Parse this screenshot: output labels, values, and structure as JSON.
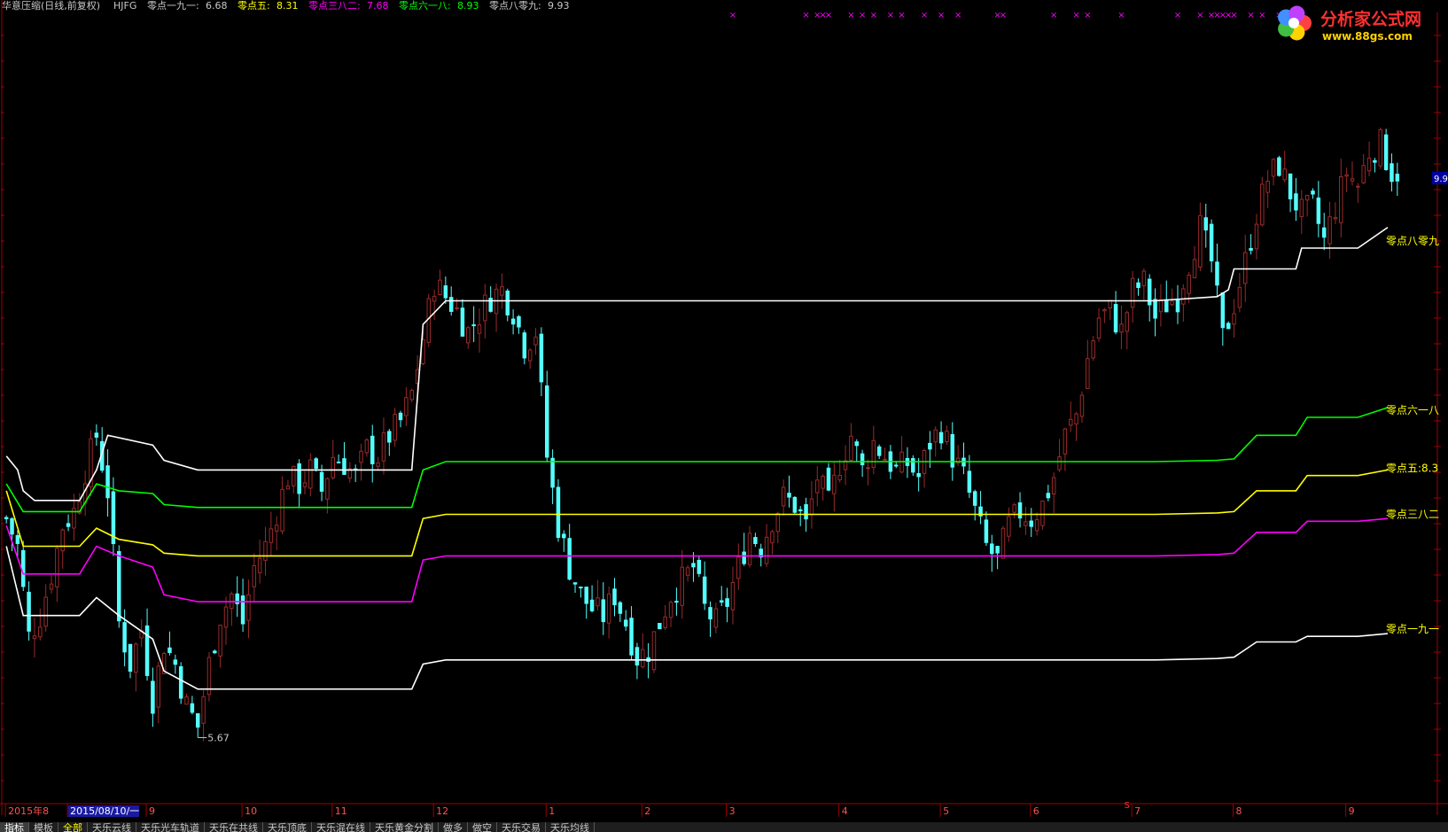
{
  "header": {
    "title": "华意压缩(日线,前复权)",
    "indicator": "HJFG",
    "items": [
      {
        "label": "零点一九一:",
        "value": "6.68",
        "color": "#ffffff"
      },
      {
        "label": "零点五:",
        "value": "8.31",
        "color": "#ffff00"
      },
      {
        "label": "零点三八二:",
        "value": "7.68",
        "color": "#ff00ff"
      },
      {
        "label": "零点六一八:",
        "value": "8.93",
        "color": "#00ff00"
      },
      {
        "label": "零点八零九:",
        "value": "9.93",
        "color": "#ffffff"
      }
    ]
  },
  "logo": {
    "name": "分析家公式网",
    "url": "www.88gs.com"
  },
  "price_scale": {
    "label": "9.9"
  },
  "chart_data": {
    "type": "candlestick",
    "title": "华意压缩(日线,前复权)",
    "ylim": [
      5.2,
      10.9
    ],
    "x_count": 248,
    "low_marker": {
      "index": 34,
      "value": 5.67,
      "label": "5.67"
    },
    "lines": [
      {
        "name": "零点八零九",
        "color": "#ffffff",
        "end_label": "零点八零九",
        "value": 9.93,
        "steps": [
          [
            0,
            7.7
          ],
          [
            2,
            7.6
          ],
          [
            3,
            7.45
          ],
          [
            5,
            7.38
          ],
          [
            13,
            7.38
          ],
          [
            16,
            7.6
          ],
          [
            18,
            7.85
          ],
          [
            26,
            7.78
          ],
          [
            28,
            7.67
          ],
          [
            34,
            7.6
          ],
          [
            50,
            7.6
          ],
          [
            56,
            7.6
          ],
          [
            72,
            7.6
          ],
          [
            74,
            8.65
          ],
          [
            78,
            8.82
          ],
          [
            95,
            8.82
          ],
          [
            204,
            8.82
          ],
          [
            215,
            8.85
          ],
          [
            217,
            8.9
          ],
          [
            218,
            9.05
          ],
          [
            229,
            9.05
          ],
          [
            230,
            9.2
          ],
          [
            240,
            9.2
          ],
          [
            248,
            9.35
          ]
        ]
      },
      {
        "name": "零点六一八",
        "color": "#00ff00",
        "end_label": "零点六一八",
        "value": 8.93,
        "steps": [
          [
            0,
            7.5
          ],
          [
            3,
            7.3
          ],
          [
            13,
            7.3
          ],
          [
            16,
            7.5
          ],
          [
            20,
            7.45
          ],
          [
            26,
            7.43
          ],
          [
            28,
            7.35
          ],
          [
            34,
            7.33
          ],
          [
            72,
            7.33
          ],
          [
            74,
            7.6
          ],
          [
            78,
            7.66
          ],
          [
            95,
            7.66
          ],
          [
            204,
            7.66
          ],
          [
            215,
            7.67
          ],
          [
            218,
            7.68
          ],
          [
            222,
            7.85
          ],
          [
            229,
            7.85
          ],
          [
            231,
            7.98
          ],
          [
            240,
            7.98
          ],
          [
            248,
            8.05
          ]
        ]
      },
      {
        "name": "零点五",
        "color": "#ffff00",
        "end_label": "零点五:8.3",
        "value": 8.31,
        "steps": [
          [
            0,
            7.45
          ],
          [
            3,
            7.05
          ],
          [
            13,
            7.05
          ],
          [
            16,
            7.18
          ],
          [
            20,
            7.1
          ],
          [
            26,
            7.06
          ],
          [
            28,
            7.0
          ],
          [
            34,
            6.98
          ],
          [
            72,
            6.98
          ],
          [
            74,
            7.25
          ],
          [
            78,
            7.28
          ],
          [
            95,
            7.28
          ],
          [
            204,
            7.28
          ],
          [
            215,
            7.29
          ],
          [
            218,
            7.3
          ],
          [
            222,
            7.45
          ],
          [
            229,
            7.45
          ],
          [
            231,
            7.56
          ],
          [
            240,
            7.56
          ],
          [
            248,
            7.6
          ]
        ]
      },
      {
        "name": "零点三八二",
        "color": "#ff00ff",
        "end_label": "零点三八二",
        "value": 7.68,
        "steps": [
          [
            0,
            7.2
          ],
          [
            3,
            6.85
          ],
          [
            13,
            6.85
          ],
          [
            16,
            7.05
          ],
          [
            20,
            6.98
          ],
          [
            26,
            6.9
          ],
          [
            28,
            6.7
          ],
          [
            34,
            6.65
          ],
          [
            72,
            6.65
          ],
          [
            74,
            6.95
          ],
          [
            78,
            6.98
          ],
          [
            95,
            6.98
          ],
          [
            204,
            6.98
          ],
          [
            215,
            6.99
          ],
          [
            218,
            7.0
          ],
          [
            222,
            7.15
          ],
          [
            229,
            7.15
          ],
          [
            231,
            7.23
          ],
          [
            240,
            7.23
          ],
          [
            248,
            7.25
          ]
        ]
      },
      {
        "name": "零点一九一",
        "color": "#ffffff",
        "end_label": "零点一九一",
        "value": 6.68,
        "steps": [
          [
            0,
            7.05
          ],
          [
            3,
            6.55
          ],
          [
            13,
            6.55
          ],
          [
            16,
            6.68
          ],
          [
            20,
            6.55
          ],
          [
            26,
            6.38
          ],
          [
            28,
            6.15
          ],
          [
            34,
            6.02
          ],
          [
            72,
            6.02
          ],
          [
            74,
            6.2
          ],
          [
            78,
            6.23
          ],
          [
            95,
            6.23
          ],
          [
            204,
            6.23
          ],
          [
            215,
            6.24
          ],
          [
            218,
            6.25
          ],
          [
            222,
            6.36
          ],
          [
            229,
            6.36
          ],
          [
            231,
            6.4
          ],
          [
            240,
            6.4
          ],
          [
            248,
            6.42
          ]
        ]
      }
    ],
    "x_ticks": [
      {
        "index": 0,
        "label": "2015年8"
      },
      {
        "index": 11,
        "label": "2015/08/10/一"
      },
      {
        "index": 25,
        "label": "9"
      },
      {
        "index": 42,
        "label": "10"
      },
      {
        "index": 58,
        "label": "11"
      },
      {
        "index": 76,
        "label": "12"
      },
      {
        "index": 96,
        "label": "1"
      },
      {
        "index": 113,
        "label": "2"
      },
      {
        "index": 128,
        "label": "3"
      },
      {
        "index": 148,
        "label": "4"
      },
      {
        "index": 166,
        "label": "5"
      },
      {
        "index": 182,
        "label": "6"
      },
      {
        "index": 200,
        "label": "7"
      },
      {
        "index": 218,
        "label": "8"
      },
      {
        "index": 238,
        "label": "9"
      }
    ],
    "x_marker": {
      "index": 199,
      "label": "S"
    },
    "signal_marks": {
      "label": "×",
      "color": "#ff00ff",
      "indices": [
        129,
        142,
        144,
        145,
        146,
        150,
        152,
        154,
        157,
        159,
        163,
        166,
        169,
        176,
        177,
        186,
        190,
        192,
        198,
        208,
        212,
        214,
        215,
        216,
        217,
        218,
        221,
        223,
        226
      ]
    },
    "anchors": [
      [
        0,
        7.25
      ],
      [
        2,
        7.05
      ],
      [
        4,
        6.4
      ],
      [
        6,
        6.55
      ],
      [
        8,
        6.85
      ],
      [
        10,
        7.2
      ],
      [
        12,
        7.3
      ],
      [
        14,
        7.6
      ],
      [
        16,
        7.85
      ],
      [
        18,
        7.45
      ],
      [
        20,
        6.5
      ],
      [
        22,
        6.2
      ],
      [
        24,
        6.45
      ],
      [
        26,
        5.95
      ],
      [
        28,
        6.35
      ],
      [
        30,
        6.2
      ],
      [
        32,
        5.9
      ],
      [
        34,
        5.75
      ],
      [
        36,
        6.2
      ],
      [
        38,
        6.55
      ],
      [
        40,
        6.7
      ],
      [
        42,
        6.5
      ],
      [
        44,
        6.9
      ],
      [
        46,
        7.05
      ],
      [
        48,
        7.3
      ],
      [
        50,
        7.55
      ],
      [
        52,
        7.5
      ],
      [
        54,
        7.6
      ],
      [
        56,
        7.45
      ],
      [
        58,
        7.7
      ],
      [
        60,
        7.65
      ],
      [
        62,
        7.55
      ],
      [
        64,
        7.75
      ],
      [
        66,
        7.7
      ],
      [
        68,
        7.85
      ],
      [
        70,
        7.95
      ],
      [
        72,
        8.15
      ],
      [
        74,
        8.55
      ],
      [
        76,
        8.95
      ],
      [
        78,
        8.85
      ],
      [
        80,
        8.75
      ],
      [
        82,
        8.6
      ],
      [
        84,
        8.72
      ],
      [
        86,
        8.85
      ],
      [
        88,
        8.9
      ],
      [
        90,
        8.75
      ],
      [
        92,
        8.5
      ],
      [
        94,
        8.6
      ],
      [
        96,
        7.7
      ],
      [
        98,
        7.2
      ],
      [
        100,
        6.9
      ],
      [
        102,
        6.7
      ],
      [
        104,
        6.6
      ],
      [
        106,
        6.55
      ],
      [
        108,
        6.7
      ],
      [
        110,
        6.5
      ],
      [
        112,
        6.25
      ],
      [
        114,
        6.3
      ],
      [
        116,
        6.5
      ],
      [
        118,
        6.7
      ],
      [
        120,
        6.8
      ],
      [
        122,
        6.9
      ],
      [
        124,
        6.6
      ],
      [
        126,
        6.5
      ],
      [
        128,
        6.65
      ],
      [
        130,
        6.9
      ],
      [
        132,
        7.15
      ],
      [
        134,
        7.05
      ],
      [
        136,
        7.25
      ],
      [
        138,
        7.4
      ],
      [
        140,
        7.35
      ],
      [
        142,
        7.2
      ],
      [
        144,
        7.55
      ],
      [
        146,
        7.35
      ],
      [
        148,
        7.65
      ],
      [
        150,
        7.85
      ],
      [
        152,
        7.6
      ],
      [
        154,
        7.8
      ],
      [
        156,
        7.7
      ],
      [
        158,
        7.6
      ],
      [
        160,
        7.65
      ],
      [
        162,
        7.55
      ],
      [
        164,
        7.8
      ],
      [
        166,
        7.9
      ],
      [
        168,
        7.7
      ],
      [
        170,
        7.55
      ],
      [
        172,
        7.3
      ],
      [
        174,
        7.05
      ],
      [
        176,
        6.95
      ],
      [
        178,
        7.2
      ],
      [
        180,
        7.3
      ],
      [
        182,
        7.25
      ],
      [
        184,
        7.35
      ],
      [
        186,
        7.55
      ],
      [
        188,
        7.85
      ],
      [
        190,
        8.0
      ],
      [
        192,
        8.4
      ],
      [
        194,
        8.7
      ],
      [
        196,
        8.75
      ],
      [
        198,
        8.6
      ],
      [
        200,
        8.9
      ],
      [
        202,
        8.95
      ],
      [
        204,
        8.7
      ],
      [
        206,
        8.8
      ],
      [
        208,
        8.85
      ],
      [
        210,
        9.1
      ],
      [
        212,
        9.35
      ],
      [
        214,
        9.1
      ],
      [
        216,
        8.55
      ],
      [
        218,
        8.8
      ],
      [
        220,
        9.1
      ],
      [
        222,
        9.45
      ],
      [
        224,
        9.7
      ],
      [
        226,
        9.8
      ],
      [
        228,
        9.6
      ],
      [
        230,
        9.45
      ],
      [
        232,
        9.5
      ],
      [
        234,
        9.25
      ],
      [
        236,
        9.5
      ],
      [
        238,
        9.75
      ],
      [
        240,
        9.65
      ],
      [
        242,
        9.9
      ],
      [
        244,
        9.95
      ],
      [
        246,
        9.75
      ],
      [
        247,
        9.75
      ]
    ]
  },
  "tabs": [
    "指标",
    "模板",
    "全部",
    "天乐云线",
    "天乐光车轨道",
    "天乐在共线",
    "天乐顶底",
    "天乐混在线",
    "天乐黄金分割",
    "做多",
    "做空",
    "天乐交易",
    "天乐均线"
  ]
}
